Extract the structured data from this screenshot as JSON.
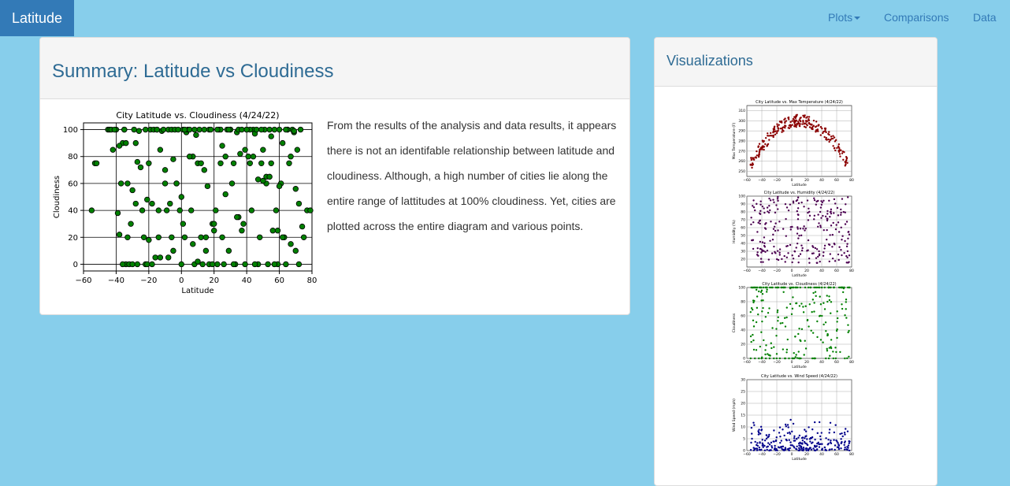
{
  "navbar": {
    "brand": "Latitude",
    "links": [
      {
        "label": "Plots",
        "dropdown": true
      },
      {
        "label": "Comparisons"
      },
      {
        "label": "Data"
      }
    ]
  },
  "summary": {
    "title": "Summary: Latitude vs Cloudiness",
    "text": "From the results of the analysis and data results, it appears there is not an identifable relationship between latitude and cloudiness. Although, a high number of cities lie along the entire range of lattitudes at 100% cloudiness. Yet, cities are plotted across the entire diagram and various points."
  },
  "visualizations": {
    "title": "Visualizations"
  },
  "colors": {
    "background": "#87ceeb",
    "brand": "#337ab7",
    "heading": "#2e6b94",
    "cloudiness_marker": "#008000",
    "temperature_marker": "#8b0000",
    "humidity_marker": "#4b0050",
    "windspeed_marker": "#00008b"
  },
  "chart_data": [
    {
      "type": "scatter",
      "title": "City Latitude vs. Cloudiness (4/24/22)",
      "xlabel": "Latitude",
      "ylabel": "Cloudiness",
      "xlim": [
        -60,
        80
      ],
      "ylim": [
        0,
        100
      ],
      "xticks": [
        -60,
        -40,
        -20,
        0,
        20,
        40,
        60,
        80
      ],
      "yticks": [
        0,
        20,
        40,
        60,
        80,
        100
      ],
      "grid": true,
      "point_count_note": "approximate sample of a dense scatter",
      "x": [
        -55,
        -53,
        -52,
        -45,
        -44,
        -42,
        -40,
        -38,
        -37,
        -36,
        -35,
        -34,
        -33,
        -32,
        -30,
        -29,
        -28,
        -27,
        -25,
        -24,
        -23,
        -22,
        -21,
        -20,
        -19,
        -18,
        -17,
        -16,
        -15,
        -14,
        -13,
        -12,
        -11,
        -10,
        -9,
        -8,
        -7,
        -6,
        -5,
        -4,
        -3,
        -2,
        -1,
        0,
        1,
        2,
        3,
        4,
        5,
        6,
        7,
        8,
        9,
        10,
        11,
        12,
        13,
        14,
        15,
        16,
        17,
        18,
        19,
        20,
        21,
        22,
        23,
        24,
        25,
        26,
        27,
        28,
        29,
        30,
        31,
        32,
        33,
        34,
        35,
        36,
        37,
        38,
        39,
        40,
        41,
        42,
        43,
        44,
        45,
        46,
        47,
        48,
        49,
        50,
        51,
        52,
        53,
        54,
        55,
        56,
        57,
        58,
        59,
        60,
        61,
        62,
        63,
        64,
        65,
        66,
        67,
        68,
        69,
        70,
        71,
        72,
        73,
        75,
        77,
        79,
        -43,
        -38,
        -36,
        -33,
        -31,
        -27,
        -22,
        -18,
        -14,
        -8,
        -3,
        2,
        7,
        12,
        17,
        22,
        27,
        32,
        37,
        42,
        47,
        52,
        57,
        62,
        67,
        72,
        -39,
        -35,
        -30,
        -26,
        -20,
        -15,
        -10,
        -5,
        0,
        5,
        10,
        15,
        20,
        25,
        30,
        35,
        40,
        45,
        50,
        55,
        60,
        65,
        70,
        -41,
        -34,
        -28,
        -21,
        -13,
        -6,
        1,
        8,
        14,
        19,
        24,
        29,
        34,
        39,
        44,
        49,
        54,
        59,
        64,
        69,
        74
      ],
      "y": [
        40,
        75,
        75,
        100,
        100,
        85,
        100,
        22,
        60,
        90,
        100,
        0,
        20,
        0,
        0,
        100,
        45,
        76,
        72,
        40,
        20,
        0,
        0,
        75,
        100,
        0,
        100,
        5,
        100,
        40,
        85,
        99,
        100,
        60,
        40,
        100,
        45,
        100,
        78,
        100,
        60,
        100,
        40,
        0,
        100,
        20,
        98,
        100,
        100,
        40,
        80,
        0,
        96,
        75,
        100,
        20,
        0,
        100,
        10,
        58,
        100,
        100,
        30,
        25,
        40,
        0,
        100,
        100,
        20,
        0,
        80,
        100,
        10,
        100,
        60,
        75,
        0,
        98,
        100,
        82,
        100,
        30,
        0,
        100,
        80,
        75,
        40,
        100,
        97,
        100,
        0,
        20,
        75,
        85,
        100,
        60,
        0,
        100,
        75,
        25,
        100,
        40,
        0,
        100,
        60,
        90,
        20,
        0,
        100,
        75,
        15,
        100,
        98,
        56,
        85,
        0,
        100,
        20,
        40,
        40,
        100,
        88,
        0,
        60,
        30,
        0,
        100,
        45,
        20,
        5,
        60,
        100,
        15,
        75,
        0,
        100,
        52,
        0,
        25,
        100,
        63,
        65,
        0,
        20,
        80,
        45,
        38,
        100,
        55,
        99,
        18,
        100,
        70,
        10,
        50,
        80,
        2,
        20,
        30,
        88,
        100,
        35,
        100,
        0,
        62,
        95,
        58,
        100,
        10,
        100,
        90,
        90,
        48,
        5,
        20,
        30,
        100,
        70,
        0,
        75,
        100,
        35,
        85,
        80,
        100,
        65,
        25,
        100,
        99,
        28,
        8,
        100,
        42,
        100,
        50,
        100,
        55,
        92,
        20,
        100,
        72,
        100,
        30
      ]
    },
    {
      "type": "scatter",
      "title": "City Latitude vs. Max Temperature (4/24/22)",
      "xlabel": "Latitude",
      "ylabel": "Max Temperature (F)",
      "xlim": [
        -60,
        80
      ],
      "ylim": [
        245,
        315
      ],
      "xticks": [
        -60,
        -40,
        -20,
        0,
        20,
        40,
        60,
        80
      ],
      "yticks": [
        250,
        260,
        270,
        280,
        290,
        300,
        310
      ],
      "grid": true
    },
    {
      "type": "scatter",
      "title": "City Latitude vs. Humidity (4/24/22)",
      "xlabel": "Latitude",
      "ylabel": "Humidity (%)",
      "xlim": [
        -60,
        80
      ],
      "ylim": [
        10,
        100
      ],
      "xticks": [
        -60,
        -40,
        -20,
        0,
        20,
        40,
        60,
        80
      ],
      "yticks": [
        20,
        30,
        40,
        50,
        60,
        70,
        80,
        90,
        100
      ],
      "grid": true
    },
    {
      "type": "scatter",
      "title": "City Latitude vs. Cloudiness (4/24/22)",
      "xlabel": "Latitude",
      "ylabel": "Cloudiness",
      "xlim": [
        -60,
        80
      ],
      "ylim": [
        0,
        100
      ],
      "xticks": [
        -60,
        -40,
        -20,
        0,
        20,
        40,
        60,
        80
      ],
      "yticks": [
        0,
        20,
        40,
        60,
        80,
        100
      ],
      "grid": true
    },
    {
      "type": "scatter",
      "title": "City Latitude vs. Wind Speed (4/24/22)",
      "xlabel": "Latitude",
      "ylabel": "Wind Speed (mph)",
      "xlim": [
        -60,
        80
      ],
      "ylim": [
        0,
        30
      ],
      "xticks": [
        -60,
        -40,
        -20,
        0,
        20,
        40,
        60,
        80
      ],
      "yticks": [
        0,
        5,
        10,
        15,
        20,
        25,
        30
      ],
      "grid": true
    }
  ]
}
